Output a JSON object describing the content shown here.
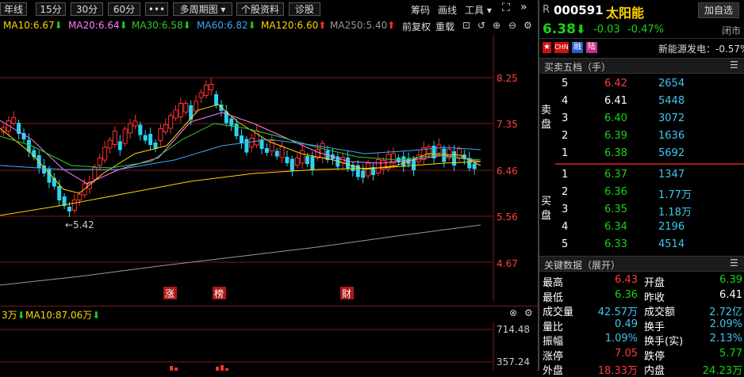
{
  "toolbar": {
    "buttons": [
      "年线",
      "15分",
      "30分",
      "60分",
      "•••",
      "多周期图 ▾",
      "个股资料",
      "诊股"
    ],
    "right": [
      "筹码",
      "画线",
      "工具 ▾"
    ],
    "expand_icon": "expand-icon"
  },
  "ma_row": {
    "ma10": "MA10:6.67",
    "ma20": "MA20:6.64",
    "ma30": "MA30:6.58",
    "ma60": "MA60:6.82",
    "ma120": "MA120:6.60",
    "ma250": "MA250:5.40",
    "ma10_dir": "down",
    "ma20_dir": "down",
    "ma30_dir": "down",
    "ma60_dir": "down",
    "ma120_dir": "up",
    "ma250_dir": "up",
    "fuquan": "前复权",
    "reload": "重载",
    "colors": {
      "ma10": "#ffd400",
      "ma20": "#ff7dff",
      "ma30": "#33cc33",
      "ma60": "#3ea6ff",
      "ma120": "#ffd400",
      "ma250": "#999999"
    }
  },
  "chart": {
    "price_labels": [
      "8.25",
      "7.35",
      "6.46",
      "5.56",
      "4.67"
    ],
    "low_annotation": "←5.42",
    "markers": [
      "涨",
      "榜",
      "财"
    ]
  },
  "volume": {
    "left_text": "3万",
    "ma10": "MA10:87.06万",
    "labels": [
      "714.48",
      "357.24"
    ]
  },
  "stock": {
    "prefix": "R",
    "code": "000591",
    "name": "太阳能",
    "add_button": "加自选",
    "price": "6.38",
    "change": "-0.03",
    "pct": "-0.47%",
    "status": "闭市",
    "flags": [
      "CHN",
      "融",
      "陆"
    ],
    "sector": "新能源发电：-0.57%"
  },
  "orderbook": {
    "title": "买卖五档（手）",
    "sell_label": "卖盘",
    "buy_label": "买盘",
    "sells": [
      {
        "lvl": "5",
        "price": "6.42",
        "vol": "2654",
        "color": "red"
      },
      {
        "lvl": "4",
        "price": "6.41",
        "vol": "5448",
        "color": "white"
      },
      {
        "lvl": "3",
        "price": "6.40",
        "vol": "3072",
        "color": "green"
      },
      {
        "lvl": "2",
        "price": "6.39",
        "vol": "1636",
        "color": "green"
      },
      {
        "lvl": "1",
        "price": "6.38",
        "vol": "5692",
        "color": "green"
      }
    ],
    "buys": [
      {
        "lvl": "1",
        "price": "6.37",
        "vol": "1347",
        "color": "green"
      },
      {
        "lvl": "2",
        "price": "6.36",
        "vol": "1.77万",
        "color": "green"
      },
      {
        "lvl": "3",
        "price": "6.35",
        "vol": "1.18万",
        "color": "green"
      },
      {
        "lvl": "4",
        "price": "6.34",
        "vol": "2196",
        "color": "green"
      },
      {
        "lvl": "5",
        "price": "6.33",
        "vol": "4514",
        "color": "green"
      }
    ]
  },
  "keydata": {
    "title": "关键数据（展开）",
    "rows": [
      {
        "l1": "最高",
        "v1": "6.43",
        "c1": "red",
        "l2": "开盘",
        "v2": "6.39",
        "c2": "green"
      },
      {
        "l1": "最低",
        "v1": "6.36",
        "c1": "green",
        "l2": "昨收",
        "v2": "6.41",
        "c2": "white"
      },
      {
        "l1": "成交量",
        "v1": "42.57万",
        "c1": "cyan",
        "l2": "成交额",
        "v2": "2.72亿",
        "c2": "cyan"
      },
      {
        "l1": "量比",
        "v1": "0.49",
        "c1": "cyan",
        "l2": "换手",
        "v2": "2.09%",
        "c2": "cyan"
      },
      {
        "l1": "振幅",
        "v1": "1.09%",
        "c1": "cyan",
        "l2": "换手(实)",
        "v2": "2.13%",
        "c2": "cyan"
      },
      {
        "l1": "涨停",
        "v1": "7.05",
        "c1": "red",
        "l2": "跌停",
        "v2": "5.77",
        "c2": "green"
      },
      {
        "l1": "外盘",
        "v1": "18.33万",
        "c1": "red",
        "l2": "内盘",
        "v2": "24.23万",
        "c2": "green"
      }
    ]
  }
}
